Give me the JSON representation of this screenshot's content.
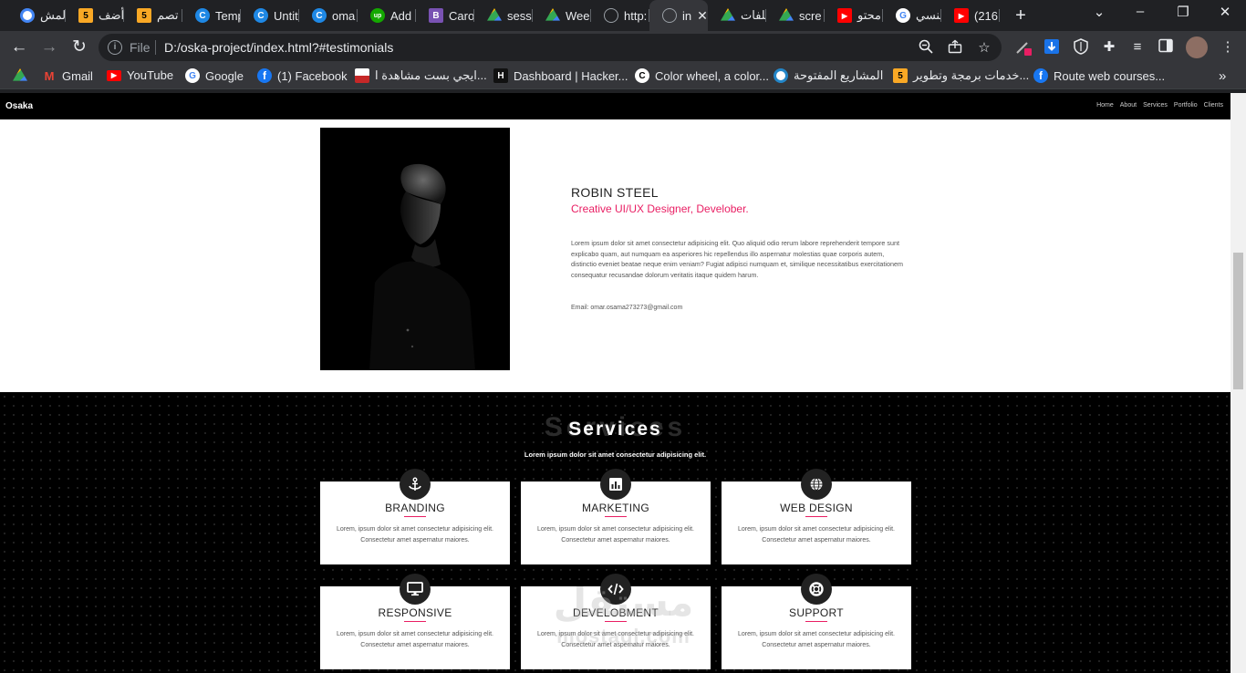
{
  "browser": {
    "tabs": [
      {
        "title": "المش",
        "icon": "circle-blue-icon",
        "color": "#4285f4"
      },
      {
        "title": "أضف",
        "icon": "five-badge-icon",
        "color": "#f9a825"
      },
      {
        "title": "تصم",
        "icon": "five-badge-icon",
        "color": "#f9a825"
      },
      {
        "title": "Temp",
        "icon": "canva-icon",
        "color": "#1e88e5"
      },
      {
        "title": "Untit",
        "icon": "canva-icon",
        "color": "#1e88e5"
      },
      {
        "title": "oma",
        "icon": "canva-icon",
        "color": "#1e88e5"
      },
      {
        "title": "Add",
        "icon": "upwork-icon",
        "color": "#14a800"
      },
      {
        "title": "Caro",
        "icon": "bootstrap-icon",
        "color": "#7952b3"
      },
      {
        "title": "sessi",
        "icon": "drive-icon",
        "color": "#34a853"
      },
      {
        "title": "Wee",
        "icon": "drive-icon",
        "color": "#34a853"
      },
      {
        "title": "http:",
        "icon": "globe-icon",
        "color": "#9aa0a6"
      },
      {
        "title": "in",
        "icon": "globe-icon",
        "color": "#9aa0a6",
        "active": true
      },
      {
        "title": "ملفات",
        "icon": "drive-icon",
        "color": "#34a853"
      },
      {
        "title": "scre",
        "icon": "drive-icon",
        "color": "#34a853"
      },
      {
        "title": "محتو",
        "icon": "youtube-icon",
        "color": "#ff0000"
      },
      {
        "title": "تنسي",
        "icon": "google-icon",
        "color": "#ffffff"
      },
      {
        "title": "(216",
        "icon": "youtube-icon",
        "color": "#ff0000"
      }
    ],
    "address": {
      "scheme": "File",
      "url": "D:/oska-project/index.html?#testimonials"
    },
    "bookmarks": [
      {
        "label": "",
        "icon": "drive-icon",
        "color": "#34a853"
      },
      {
        "label": "Gmail",
        "icon": "gmail-icon",
        "color": "#ea4335"
      },
      {
        "label": "YouTube",
        "icon": "youtube-icon",
        "color": "#ff0000"
      },
      {
        "label": "Google",
        "icon": "google-icon",
        "color": "#ffffff"
      },
      {
        "label": "(1) Facebook",
        "icon": "facebook-icon",
        "color": "#1877f2"
      },
      {
        "label": "ايجي بست مشاهدة ا...",
        "icon": "egybest-icon",
        "color": "#ffffff"
      },
      {
        "label": "Dashboard | Hacker...",
        "icon": "hackerrank-icon",
        "color": "#1ba94c"
      },
      {
        "label": "Color wheel, a color...",
        "icon": "canva-icon",
        "color": "#ffffff"
      },
      {
        "label": "المشاريع المفتوحة",
        "icon": "mostaql-icon",
        "color": "#2386c8"
      },
      {
        "label": "خدمات برمجة وتطوير...",
        "icon": "five-badge-icon",
        "color": "#f9a825"
      },
      {
        "label": "Route web courses...",
        "icon": "facebook-icon",
        "color": "#1877f2"
      }
    ]
  },
  "site": {
    "brand": "Osaka",
    "nav": [
      "Home",
      "About",
      "Services",
      "Portfolio",
      "Clients"
    ],
    "about": {
      "name": "ROBIN STEEL",
      "role": "Creative UI/UX Designer, Develober.",
      "text": "Lorem ipsum dolor sit amet consectetur adipisicing elit. Quo aliquid odio rerum labore reprehenderit tempore sunt explicabo quam, aut numquam ea asperiores hic repellendus illo aspernatur molestias quae corporis autem, distinctio eveniet beatae neque enim veniam? Fugiat adipisci numquam et, similique necessitatibus exercitationem consequatur recusandae dolorum veritatis itaque quidem harum.",
      "email": "Email: omar.osama273273@gmail.com"
    },
    "services": {
      "bg_title": "Services",
      "title": "Services",
      "subtitle": "Lorem ipsum dolor sit amet consectetur adipisicing elit.",
      "cards": [
        {
          "title": "BRANDING",
          "icon": "anchor-icon",
          "desc": "Lorem, ipsum dolor sit amet consectetur adipisicing elit. Consectetur amet aspernatur maiores."
        },
        {
          "title": "MARKETING",
          "icon": "bar-chart-icon",
          "desc": "Lorem, ipsum dolor sit amet consectetur adipisicing elit. Consectetur amet aspernatur maiores."
        },
        {
          "title": "WEB DESIGN",
          "icon": "globe-icon",
          "desc": "Lorem, ipsum dolor sit amet consectetur adipisicing elit. Consectetur amet aspernatur maiores."
        },
        {
          "title": "RESPONSIVE",
          "icon": "desktop-icon",
          "desc": "Lorem, ipsum dolor sit amet consectetur adipisicing elit. Consectetur amet aspernatur maiores."
        },
        {
          "title": "DEVELOBMENT",
          "icon": "code-icon",
          "desc": "Lorem, ipsum dolor sit amet consectetur adipisicing elit. Consectetur amet aspernatur maiores."
        },
        {
          "title": "SUPPORT",
          "icon": "lifebuoy-icon",
          "desc": "Lorem, ipsum dolor sit amet consectetur adipisicing elit. Consectetur amet aspernatur maiores."
        }
      ]
    },
    "accent": "#e91e63"
  },
  "watermark": {
    "arabic": "مستقل",
    "latin": "mostaql.com"
  }
}
